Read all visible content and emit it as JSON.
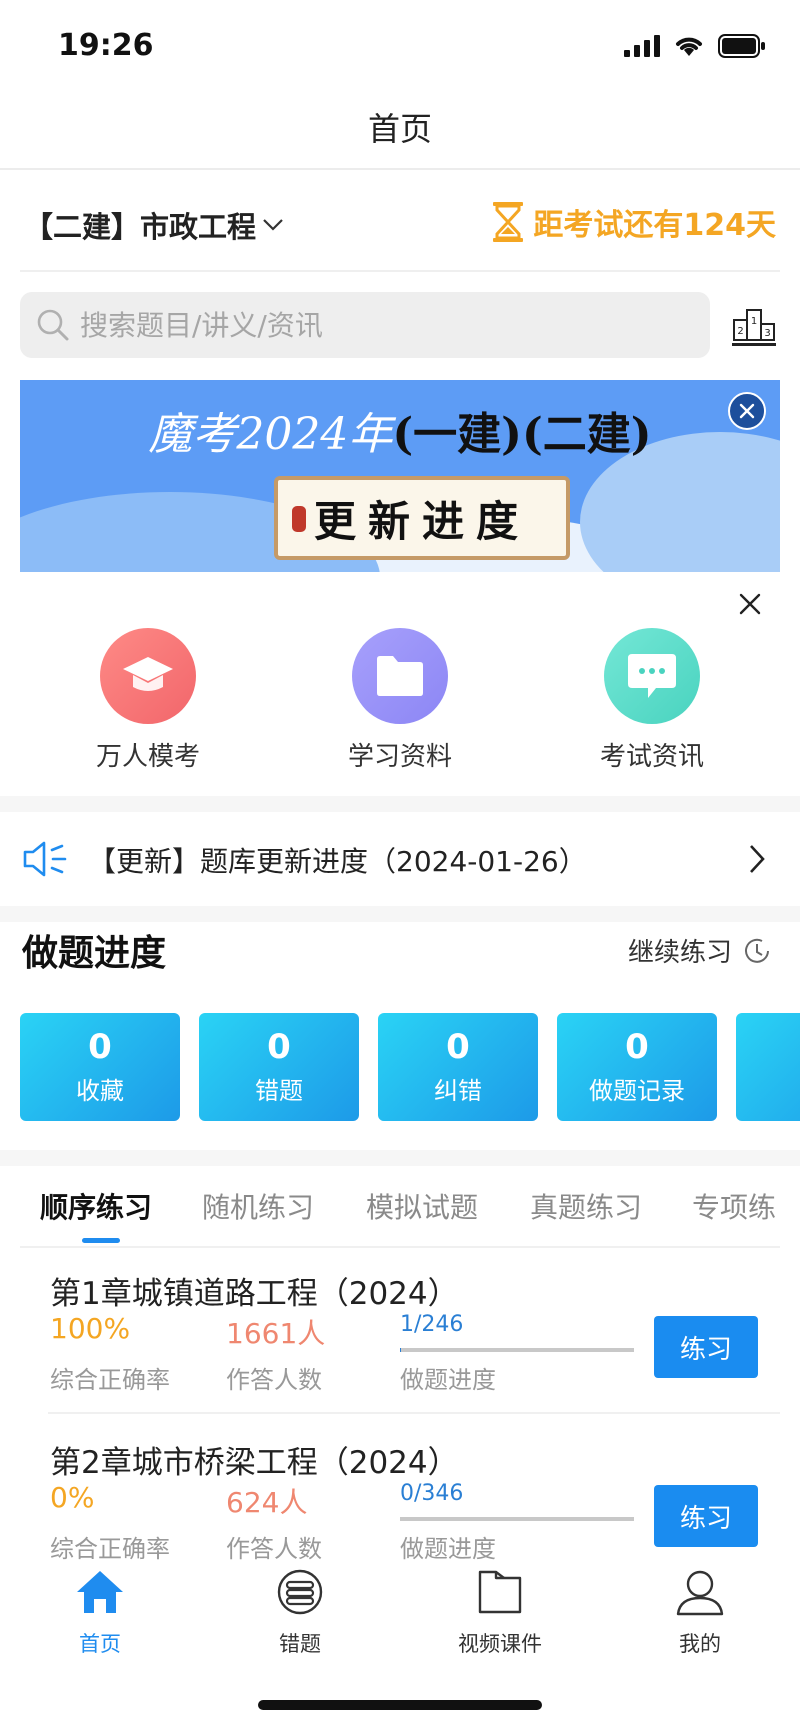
{
  "status_bar": {
    "time": "19:26"
  },
  "nav": {
    "title": "首页"
  },
  "exam": {
    "selected": "【二建】市政工程",
    "countdown": "距考试还有124天"
  },
  "search": {
    "placeholder": "搜索题目/讲义/资讯"
  },
  "banner": {
    "title_part1": "魔考2024年",
    "title_part2": "(一建)(二建)",
    "plaque_text": "更新进度"
  },
  "quick_entries": [
    {
      "label": "万人模考",
      "icon": "graduation-cap-icon",
      "color_from": "#fe8a86",
      "color_to": "#f2666b"
    },
    {
      "label": "学习资料",
      "icon": "folder-icon",
      "color_from": "#a7a0fb",
      "color_to": "#8c86f5"
    },
    {
      "label": "考试资讯",
      "icon": "chat-bubble-icon",
      "color_from": "#74e7d6",
      "color_to": "#49d3bf"
    }
  ],
  "notice": {
    "text": "【更新】题库更新进度（2024-01-26）"
  },
  "progress": {
    "title": "做题进度",
    "continue_label": "继续练习",
    "cards": [
      {
        "value": "0",
        "label": "收藏"
      },
      {
        "value": "0",
        "label": "错题"
      },
      {
        "value": "0",
        "label": "纠错"
      },
      {
        "value": "0",
        "label": "做题记录"
      }
    ]
  },
  "tabs": [
    "顺序练习",
    "随机练习",
    "模拟试题",
    "真题练习",
    "专项练"
  ],
  "chapters": [
    {
      "title": "第1章城镇道路工程（2024）",
      "rate": "100%",
      "rate_label": "综合正确率",
      "count": "1661人",
      "count_label": "作答人数",
      "progress_text": "1/246",
      "progress_fraction": 0.004,
      "progress_label": "做题进度",
      "button": "练习"
    },
    {
      "title": "第2章城市桥梁工程（2024）",
      "rate": "0%",
      "rate_label": "综合正确率",
      "count": "624人",
      "count_label": "作答人数",
      "progress_text": "0/346",
      "progress_fraction": 0,
      "progress_label": "做题进度",
      "button": "练习"
    }
  ],
  "tab_bar": [
    {
      "label": "首页",
      "icon": "home-icon",
      "active": true
    },
    {
      "label": "错题",
      "icon": "wrong-questions-icon",
      "active": false
    },
    {
      "label": "视频课件",
      "icon": "video-folder-icon",
      "active": false
    },
    {
      "label": "我的",
      "icon": "user-icon",
      "active": false
    }
  ],
  "colors": {
    "accent": "#1f8cef",
    "countdown": "#f4a623",
    "rate": "#f4a623",
    "count": "#ef8770"
  }
}
